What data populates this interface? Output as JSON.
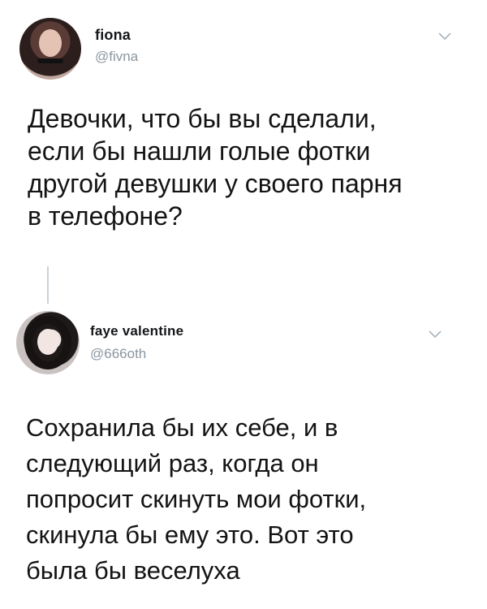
{
  "tweets": [
    {
      "display_name": "fiona",
      "handle": "@fivna",
      "text": "Девочки, что бы вы сделали,\nесли бы нашли голые фотки\nдругой девушки у своего парня\nв телефоне?",
      "avatar_icon": "user-avatar-photo",
      "menu_icon": "chevron-down-icon"
    },
    {
      "display_name": "faye valentine",
      "handle": "@666oth",
      "text": "Сохранила бы их себе, и в\nследующий раз, когда он\nпопросит скинуть мои фотки,\nскинула бы ему это. Вот это\nбыла бы веселуха",
      "avatar_icon": "user-avatar-photo",
      "menu_icon": "chevron-down-icon"
    }
  ],
  "colors": {
    "handle": "#8a96a0",
    "text": "#141414",
    "thread_line": "#c9d1d7",
    "chevron": "#aab4bc"
  }
}
